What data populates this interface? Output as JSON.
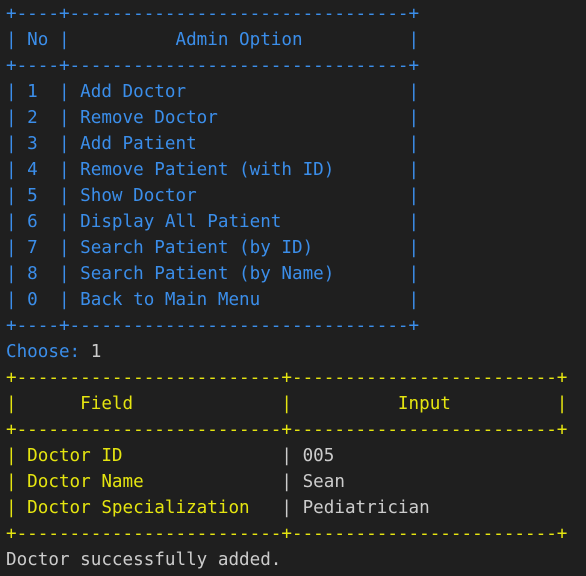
{
  "colors": {
    "background": "#1f1f1f",
    "menu": "#3b8eea",
    "form": "#e5e510",
    "text": "#cccccc"
  },
  "menu": {
    "border": "+----+--------------------------------+",
    "header_row": "| No |          Admin Option          |",
    "rows": [
      "| 1  | Add Doctor                     |",
      "| 2  | Remove Doctor                  |",
      "| 3  | Add Patient                    |",
      "| 4  | Remove Patient (with ID)       |",
      "| 5  | Show Doctor                    |",
      "| 6  | Display All Patient            |",
      "| 7  | Search Patient (by ID)         |",
      "| 8  | Search Patient (by Name)       |",
      "| 0  | Back to Main Menu              |"
    ]
  },
  "prompt": {
    "label": "Choose:",
    "value": "1"
  },
  "form": {
    "border": "+-------------------------+-------------------------+",
    "header_row": "|      Field              |          Input          |",
    "rows": [
      {
        "field": "| Doctor ID               ",
        "sep": "|",
        "input": " 005"
      },
      {
        "field": "| Doctor Name             ",
        "sep": "|",
        "input": " Sean"
      },
      {
        "field": "| Doctor Specialization   ",
        "sep": "|",
        "input": " Pediatrician"
      }
    ]
  },
  "status": "Doctor successfully added."
}
